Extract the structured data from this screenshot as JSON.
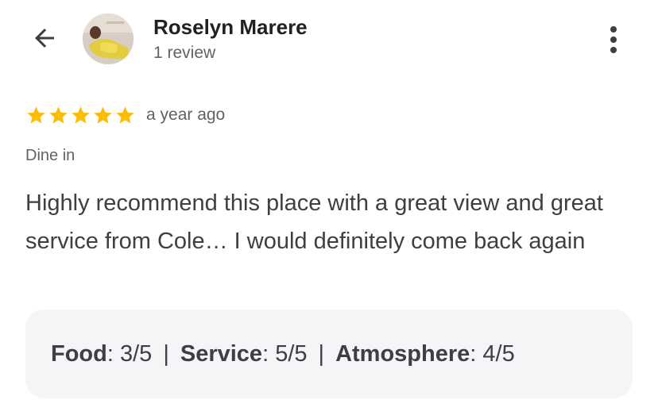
{
  "header": {
    "back_icon": "arrow-back-icon",
    "reviewer_name": "Roselyn Marere",
    "review_count": "1 review",
    "more_icon": "more-vert-icon"
  },
  "review": {
    "rating": 5,
    "rating_max": 5,
    "star_color": "#fbbc04",
    "timestamp": "a year ago",
    "dine_mode": "Dine in",
    "text": "Highly recommend this place with a great view and great service from Cole… I would definitely come back again"
  },
  "sub_ratings": {
    "separator": "|",
    "items": [
      {
        "label": "Food",
        "value": "3/5"
      },
      {
        "label": "Service",
        "value": "5/5"
      },
      {
        "label": "Atmosphere",
        "value": "4/5"
      }
    ]
  }
}
